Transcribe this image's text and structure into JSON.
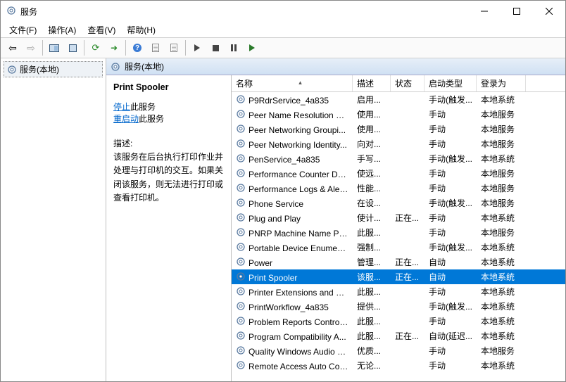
{
  "window": {
    "title": "服务"
  },
  "menu": {
    "file": "文件(F)",
    "action": "操作(A)",
    "view": "查看(V)",
    "help": "帮助(H)"
  },
  "tree": {
    "root": "服务(本地)"
  },
  "header2": "服务(本地)",
  "detail": {
    "name": "Print Spooler",
    "stop_link": "停止",
    "stop_suffix": "此服务",
    "restart_link": "重启动",
    "restart_suffix": "此服务",
    "desc_label": "描述:",
    "desc": "该服务在后台执行打印作业并处理与打印机的交互。如果关闭该服务，则无法进行打印或查看打印机。"
  },
  "columns": {
    "name": "名称",
    "desc": "描述",
    "status": "状态",
    "startup": "启动类型",
    "logon": "登录为"
  },
  "services": [
    {
      "n": "P9RdrService_4a835",
      "d": "启用...",
      "s": "",
      "t": "手动(触发...",
      "l": "本地系统"
    },
    {
      "n": "Peer Name Resolution Pr...",
      "d": "使用...",
      "s": "",
      "t": "手动",
      "l": "本地服务"
    },
    {
      "n": "Peer Networking Groupi...",
      "d": "使用...",
      "s": "",
      "t": "手动",
      "l": "本地服务"
    },
    {
      "n": "Peer Networking Identity...",
      "d": "向对...",
      "s": "",
      "t": "手动",
      "l": "本地服务"
    },
    {
      "n": "PenService_4a835",
      "d": "手写...",
      "s": "",
      "t": "手动(触发...",
      "l": "本地系统"
    },
    {
      "n": "Performance Counter DL...",
      "d": "使远...",
      "s": "",
      "t": "手动",
      "l": "本地服务"
    },
    {
      "n": "Performance Logs & Aler...",
      "d": "性能...",
      "s": "",
      "t": "手动",
      "l": "本地服务"
    },
    {
      "n": "Phone Service",
      "d": "在设...",
      "s": "",
      "t": "手动(触发...",
      "l": "本地服务"
    },
    {
      "n": "Plug and Play",
      "d": "使计...",
      "s": "正在...",
      "t": "手动",
      "l": "本地系统"
    },
    {
      "n": "PNRP Machine Name Pu...",
      "d": "此服...",
      "s": "",
      "t": "手动",
      "l": "本地服务"
    },
    {
      "n": "Portable Device Enumera...",
      "d": "强制...",
      "s": "",
      "t": "手动(触发...",
      "l": "本地系统"
    },
    {
      "n": "Power",
      "d": "管理...",
      "s": "正在...",
      "t": "自动",
      "l": "本地系统"
    },
    {
      "n": "Print Spooler",
      "d": "该服...",
      "s": "正在...",
      "t": "自动",
      "l": "本地系统",
      "sel": true
    },
    {
      "n": "Printer Extensions and N...",
      "d": "此服...",
      "s": "",
      "t": "手动",
      "l": "本地系统"
    },
    {
      "n": "PrintWorkflow_4a835",
      "d": "提供...",
      "s": "",
      "t": "手动(触发...",
      "l": "本地系统"
    },
    {
      "n": "Problem Reports Control...",
      "d": "此服...",
      "s": "",
      "t": "手动",
      "l": "本地系统"
    },
    {
      "n": "Program Compatibility A...",
      "d": "此服...",
      "s": "正在...",
      "t": "自动(延迟...",
      "l": "本地系统"
    },
    {
      "n": "Quality Windows Audio V...",
      "d": "优质...",
      "s": "",
      "t": "手动",
      "l": "本地服务"
    },
    {
      "n": "Remote Access Auto Con...",
      "d": "无论...",
      "s": "",
      "t": "手动",
      "l": "本地系统"
    }
  ]
}
